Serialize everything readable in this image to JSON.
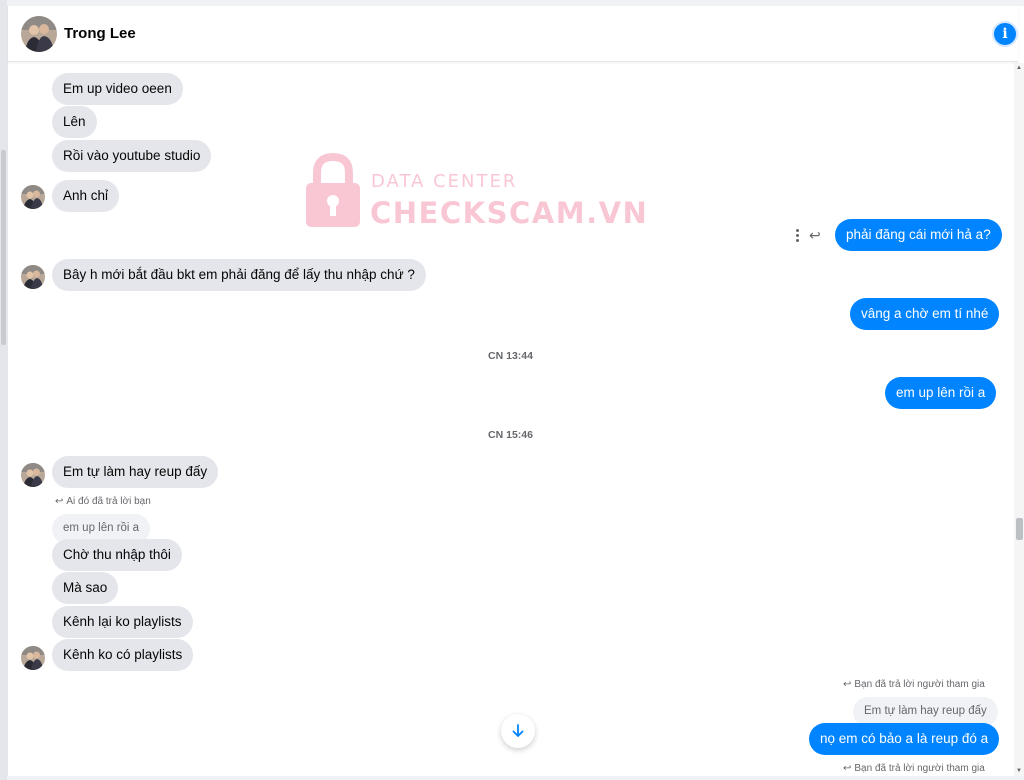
{
  "header": {
    "contact_name": "Trong Lee",
    "info_icon": "info-icon",
    "info_glyph": "i"
  },
  "watermark": {
    "line1": "DATA CENTER",
    "line2": "CHECKSCAM.VN",
    "color": "#f59ab2"
  },
  "colors": {
    "outgoing_bubble": "#0084ff",
    "incoming_bubble": "#e4e6eb",
    "timestamp": "#65676b"
  },
  "messages": {
    "m1": "Em up video oeen",
    "m2": "Lên",
    "m3": "Rồi vào youtube studio",
    "m4": "Anh chỉ",
    "m5": "phải đăng cái mới hả a?",
    "m6": "Bây h mới bắt đầu bkt em phải đăng để lấy thu nhập chứ ?",
    "m7": "vâng a chờ em tí nhé",
    "ts1": "CN 13:44",
    "m8": "em up lên rồi a",
    "ts2": "CN 15:46",
    "m9": "Em tự làm hay reup đấy",
    "reply1_note": "Ai đó đã trả lời bạn",
    "reply1_quote": "em up lên rồi a",
    "m10": "Chờ thu nhập thôi",
    "m11": "Mà sao",
    "m12": "Kênh lại ko playlists",
    "m13": "Kênh ko có playlists",
    "reply2_note": "Bạn đã trả lời người tham gia",
    "reply2_quote": "Em tự làm hay reup đấy",
    "m14": "nọ em có bảo a là reup đó a",
    "reply3_note": "Bạn đã trả lời người tham gia"
  }
}
